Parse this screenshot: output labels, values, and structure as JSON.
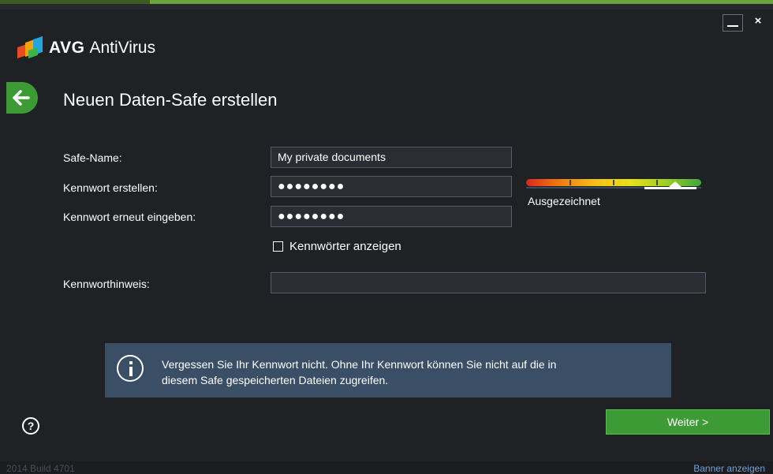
{
  "window": {
    "minimize_label": "",
    "close_label": "×"
  },
  "app": {
    "brand": "AVG",
    "product": "AntiVirus"
  },
  "page": {
    "title": "Neuen Daten-Safe erstellen"
  },
  "form": {
    "safe_name_label": "Safe-Name:",
    "safe_name_value": "My private documents",
    "password_label": "Kennwort erstellen:",
    "password_value": "●●●●●●●●",
    "password_repeat_label": "Kennwort erneut eingeben:",
    "password_repeat_value": "●●●●●●●●",
    "show_passwords_label": "Kennwörter anzeigen",
    "show_passwords_checked": false,
    "hint_label": "Kennworthinweis:",
    "hint_value": ""
  },
  "strength": {
    "label": "Ausgezeichnet",
    "level": 0.85
  },
  "info": {
    "text_line1": "Vergessen Sie Ihr Kennwort nicht. Ohne Ihr Kennwort können Sie nicht auf die in",
    "text_line2": "diesem Safe gespeicherten Dateien zugreifen."
  },
  "actions": {
    "next_label": "Weiter >",
    "help_label": "?"
  },
  "footer": {
    "build": "2014  Build 4701",
    "banner_link": "Banner anzeigen"
  },
  "colors": {
    "accent_green": "#3d9b35",
    "info_bg": "#3a4f66",
    "background": "#1f2125",
    "link": "#6fa2d6"
  }
}
